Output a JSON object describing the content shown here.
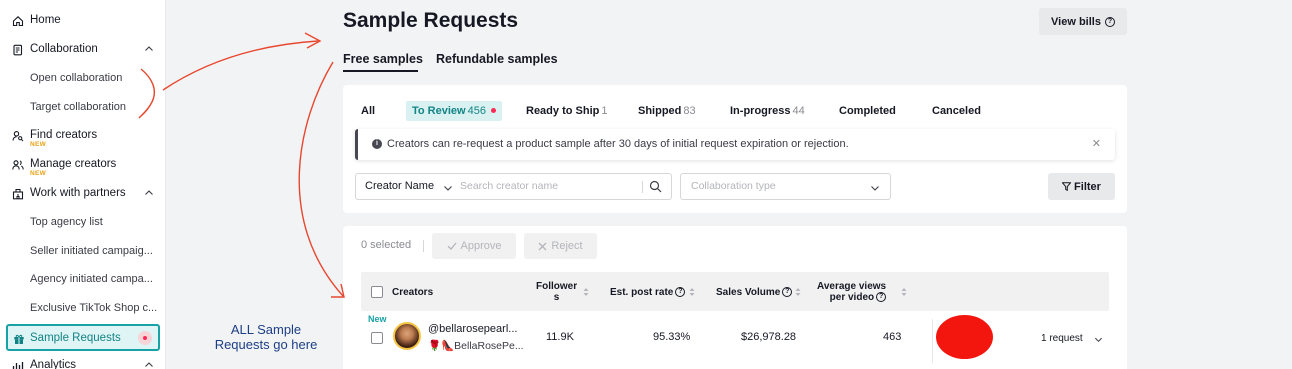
{
  "sidebar": {
    "items": [
      {
        "label": "Home"
      },
      {
        "label": "Collaboration"
      },
      {
        "label": "Open collaboration"
      },
      {
        "label": "Target collaboration"
      },
      {
        "label": "Find creators",
        "badge": "NEW"
      },
      {
        "label": "Manage creators",
        "badge": "NEW"
      },
      {
        "label": "Work with partners"
      },
      {
        "label": "Top agency list"
      },
      {
        "label": "Seller initiated campaig..."
      },
      {
        "label": "Agency initiated campa..."
      },
      {
        "label": "Exclusive TikTok Shop c..."
      },
      {
        "label": "Sample Requests"
      },
      {
        "label": "Analytics"
      }
    ]
  },
  "header": {
    "title": "Sample Requests",
    "view_bills": "View bills"
  },
  "top_tabs": [
    {
      "label": "Free samples"
    },
    {
      "label": "Refundable samples"
    }
  ],
  "status_tabs": [
    {
      "label": "All",
      "count": ""
    },
    {
      "label": "To Review",
      "count": "456"
    },
    {
      "label": "Ready to Ship",
      "count": "1"
    },
    {
      "label": "Shipped",
      "count": "83"
    },
    {
      "label": "In-progress",
      "count": "44"
    },
    {
      "label": "Completed",
      "count": ""
    },
    {
      "label": "Canceled",
      "count": ""
    }
  ],
  "notice": {
    "text": "Creators can re-request a product sample after 30 days of initial request expiration or rejection."
  },
  "filters": {
    "creator_field": "Creator Name",
    "search_placeholder": "Search creator name",
    "collab_placeholder": "Collaboration type",
    "filter_label": "Filter"
  },
  "actions": {
    "selected": "0 selected",
    "approve": "Approve",
    "reject": "Reject"
  },
  "table": {
    "columns": {
      "creators": "Creators",
      "followers_line1": "Follower",
      "followers_line2": "s",
      "post_rate": "Est. post rate",
      "sales_volume": "Sales Volume",
      "avg_views_line1": "Average views",
      "avg_views_line2": "per video"
    },
    "rows": [
      {
        "tag": "New",
        "handle": "@bellarosepearl...",
        "nickname": "🌹👠BellaRosePe...",
        "followers": "11.9K",
        "post_rate": "95.33%",
        "sales_volume": "$26,978.28",
        "avg_views": "463",
        "requests": "1 request"
      }
    ]
  },
  "annotation": {
    "line1": "ALL Sample",
    "line2": "Requests go here",
    "color": "#1d3f86",
    "arrow_color": "#e8472e"
  },
  "colors": {
    "accent": "#17a2a6",
    "active_bg": "#dff4f4",
    "alert_dot": "#fe2c55",
    "new_badge": "#e8a317",
    "redaction": "#f3160e"
  }
}
